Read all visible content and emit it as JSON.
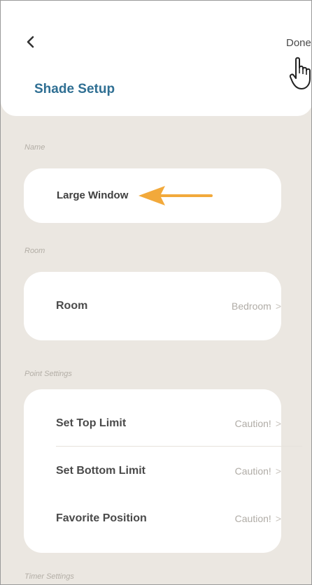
{
  "header": {
    "title": "Shade Setup",
    "done_label": "Done",
    "back_icon": "chevron-left-icon",
    "pointer_icon": "hand-pointer-icon"
  },
  "name_section": {
    "label": "Name",
    "value": "Large Window",
    "annotation": "arrow-left-icon",
    "annotation_color": "#f2a93b"
  },
  "room_section": {
    "label": "Room",
    "row_label": "Room",
    "row_value": "Bedroom",
    "chevron": "chevron-right-icon"
  },
  "point_settings": {
    "label": "Point Settings",
    "rows": [
      {
        "label": "Set Top Limit",
        "value": "Caution!"
      },
      {
        "label": "Set Bottom Limit",
        "value": "Caution!"
      },
      {
        "label": "Favorite Position",
        "value": "Caution!"
      }
    ]
  },
  "timer_settings": {
    "label": "Timer Settings"
  },
  "colors": {
    "background": "#ebe7e1",
    "title": "#2f6f93",
    "card": "#ffffff"
  }
}
